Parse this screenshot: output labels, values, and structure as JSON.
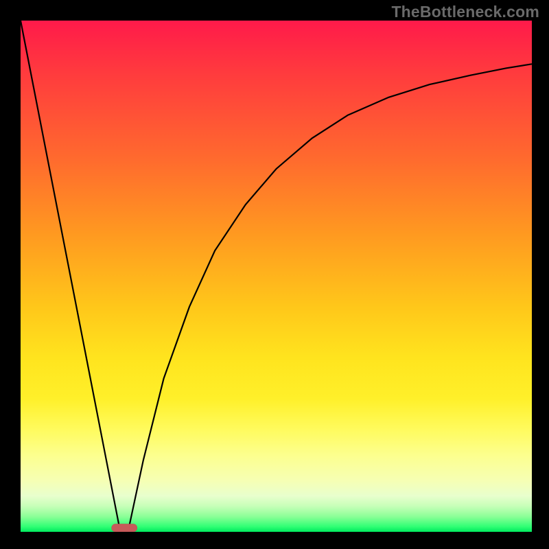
{
  "watermark": "TheBottleneck.com",
  "chart_data": {
    "type": "line",
    "title": "",
    "xlabel": "",
    "ylabel": "",
    "xlim": [
      0,
      100
    ],
    "ylim": [
      0,
      100
    ],
    "grid": false,
    "legend": false,
    "series": [
      {
        "name": "left-linear-drop",
        "x": [
          0,
          19.5
        ],
        "values": [
          100,
          0
        ]
      },
      {
        "name": "right-rising-curve",
        "x": [
          21,
          24,
          28,
          33,
          38,
          44,
          50,
          57,
          64,
          72,
          80,
          88,
          95,
          100
        ],
        "values": [
          0,
          14,
          30,
          44,
          55,
          64,
          71,
          77,
          81.5,
          85,
          87.5,
          89.3,
          90.7,
          91.5
        ]
      }
    ],
    "marker": {
      "label": "optimal-marker",
      "x_center": 20.3,
      "y": 0,
      "width": 5,
      "height": 1.6,
      "color": "#c75a5a"
    },
    "background": {
      "type": "vertical-gradient",
      "stops": [
        {
          "pos": 0.0,
          "color": "#ff1a4a"
        },
        {
          "pos": 0.27,
          "color": "#ff6a2e"
        },
        {
          "pos": 0.56,
          "color": "#ffc71a"
        },
        {
          "pos": 0.74,
          "color": "#fff02a"
        },
        {
          "pos": 0.9,
          "color": "#f6ffb4"
        },
        {
          "pos": 0.97,
          "color": "#8cff97"
        },
        {
          "pos": 1.0,
          "color": "#00e85e"
        }
      ]
    }
  }
}
